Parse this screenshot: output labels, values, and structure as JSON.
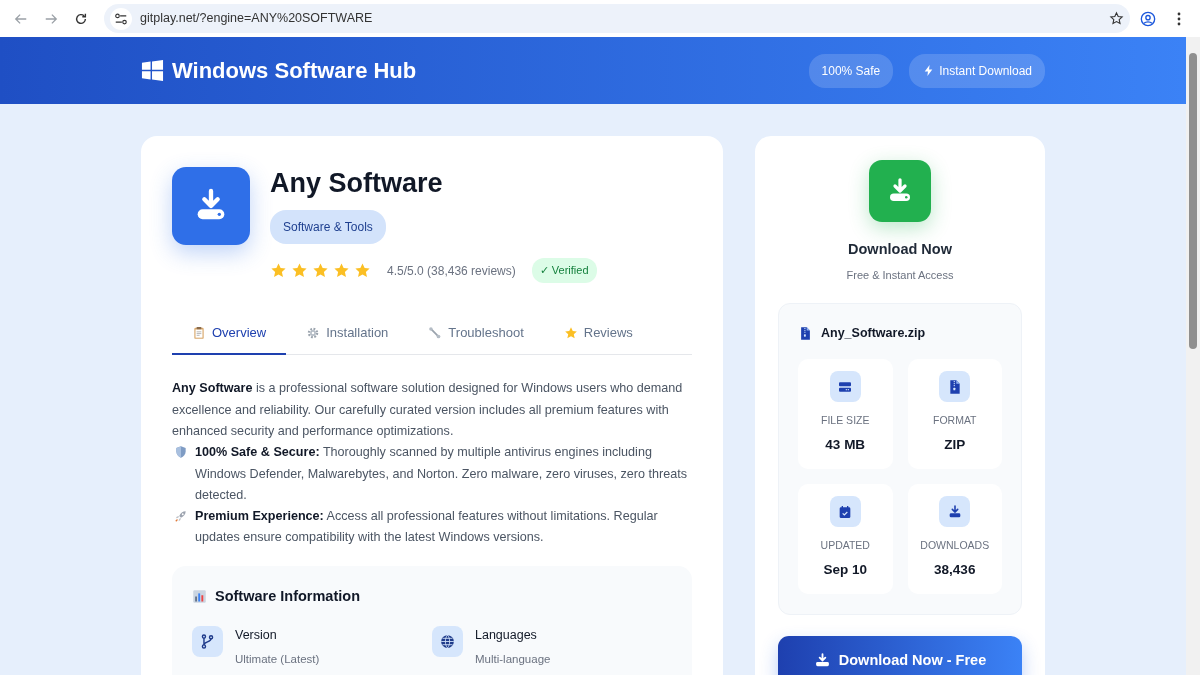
{
  "browser": {
    "url": "gitplay.net/?engine=ANY%20SOFTWARE"
  },
  "header": {
    "brand": "Windows Software Hub",
    "badges": [
      {
        "label": "100% Safe",
        "kind": "plain"
      },
      {
        "label": "Instant Download",
        "kind": "bolt"
      }
    ]
  },
  "app": {
    "title": "Any Software",
    "category": "Software & Tools",
    "stars": 5,
    "rating": "4.5/5.0 (38,436 reviews)",
    "verified": "✓ Verified"
  },
  "tabs": [
    {
      "label": "Overview",
      "kind": "clipboard",
      "selected": true
    },
    {
      "label": "Installation",
      "kind": "gear",
      "selected": false
    },
    {
      "label": "Troubleshoot",
      "kind": "wrench",
      "selected": false
    },
    {
      "label": "Reviews",
      "kind": "star",
      "selected": false
    }
  ],
  "description": [
    {
      "kind": "plain",
      "text": "**Any Software** is a professional software solution designed for Windows users who demand excellence and reliability. Our carefully curated version includes all premium features with enhanced security and performance optimizations."
    },
    {
      "kind": "shield",
      "text": "**100% Safe & Secure:** Thoroughly scanned by multiple antivirus engines including Windows Defender, Malwarebytes, and Norton. Zero malware, zero viruses, zero threats detected."
    },
    {
      "kind": "rocket",
      "text": "**Premium Experience:** Access all professional features without limitations. Regular updates ensure compatibility with the latest Windows versions."
    }
  ],
  "info": {
    "title": "Software Information",
    "items": [
      {
        "kind": "branch",
        "label": "Version",
        "value": "Ultimate (Latest)"
      },
      {
        "kind": "globe",
        "label": "Languages",
        "value": "Multi-language"
      }
    ]
  },
  "download": {
    "title": "Download Now",
    "subtitle": "Free & Instant Access",
    "file_name": "Any_Software.zip",
    "stats": [
      {
        "kind": "drive",
        "label": "FILE SIZE",
        "value": "43 MB"
      },
      {
        "kind": "file",
        "label": "FORMAT",
        "value": "ZIP"
      },
      {
        "kind": "calendar",
        "label": "UPDATED",
        "value": "Sep 10"
      },
      {
        "kind": "download",
        "label": "DOWNLOADS",
        "value": "38,436"
      }
    ],
    "button": "Download Now - Free"
  }
}
